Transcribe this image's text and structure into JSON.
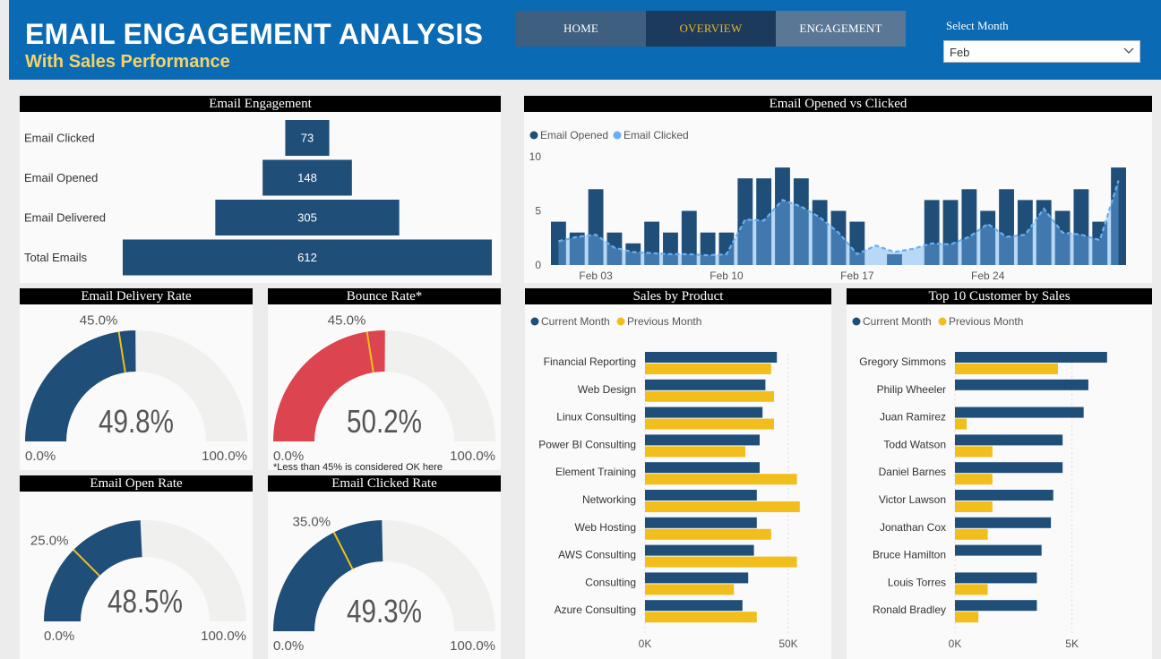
{
  "header": {
    "title": "EMAIL ENGAGEMENT ANALYSIS",
    "subtitle": "With Sales Performance",
    "nav": [
      "HOME",
      "OVERVIEW",
      "ENGAGEMENT"
    ],
    "select_label": "Select Month",
    "select_value": "Feb"
  },
  "colors": {
    "navy": "#1f4e79",
    "light_blue": "#6ab0f0",
    "yellow": "#f2be1b",
    "red": "#dc4450",
    "gauge_bg": "#f0f0ef"
  },
  "chart_data": [
    {
      "type": "bar",
      "title": "Email Engagement",
      "categories": [
        "Email Clicked",
        "Email Opened",
        "Email Delivered",
        "Total Emails"
      ],
      "values": [
        73,
        148,
        305,
        612
      ]
    },
    {
      "type": "line",
      "title": "Email Opened vs Clicked",
      "legend": [
        "Email Opened",
        "Email Clicked"
      ],
      "x_ticks": [
        "Feb 03",
        "Feb 10",
        "Feb 17",
        "Feb 24"
      ],
      "y_ticks": [
        "0",
        "5",
        "10"
      ],
      "ylim": [
        0,
        10
      ],
      "series": [
        {
          "name": "Email Opened",
          "values": [
            4,
            3,
            7,
            3,
            2,
            4,
            3,
            5,
            3,
            3,
            8,
            8,
            9,
            8,
            6,
            5,
            4,
            0,
            1,
            0,
            6,
            6,
            7,
            5,
            7,
            6,
            6,
            5,
            7,
            4,
            9
          ]
        },
        {
          "name": "Email Clicked",
          "values": [
            2.2,
            2.6,
            2.8,
            1.6,
            1.2,
            1.1,
            1.0,
            1.0,
            0.9,
            1.0,
            4.2,
            4.1,
            6.0,
            5.4,
            4.4,
            3.0,
            1.0,
            1.8,
            1.2,
            1.5,
            2.0,
            1.9,
            2.6,
            3.8,
            2.6,
            2.8,
            5.2,
            3.0,
            2.8,
            2.3,
            7.8
          ]
        }
      ]
    },
    {
      "type": "gauge",
      "title": "Email Delivery Rate",
      "value_label": "49.8%",
      "value": 49.8,
      "target_label": "45.0%",
      "target": 45.0,
      "min_label": "0.0%",
      "max_label": "100.0%"
    },
    {
      "type": "gauge",
      "title": "Bounce Rate*",
      "value_label": "50.2%",
      "value": 50.2,
      "target_label": "45.0%",
      "target": 45.0,
      "min_label": "0.0%",
      "max_label": "100.0%",
      "note": "*Less than 45% is considered OK here"
    },
    {
      "type": "gauge",
      "title": "Email Open Rate",
      "value_label": "48.5%",
      "value": 48.5,
      "target_label": "25.0%",
      "target": 25.0,
      "min_label": "0.0%",
      "max_label": "100.0%"
    },
    {
      "type": "gauge",
      "title": "Email Clicked Rate",
      "value_label": "49.3%",
      "value": 49.3,
      "target_label": "35.0%",
      "target": 35.0,
      "min_label": "0.0%",
      "max_label": "100.0%"
    },
    {
      "type": "bar",
      "title": "Sales by Product",
      "legend": [
        "Current Month",
        "Previous Month"
      ],
      "categories": [
        "Financial Reporting",
        "Web Design",
        "Linux Consulting",
        "Power BI Consulting",
        "Element Training",
        "Networking",
        "Web Hosting",
        "AWS Consulting",
        "Consulting",
        "Azure Consulting"
      ],
      "series": [
        {
          "name": "Current Month",
          "values": [
            46000,
            42000,
            41000,
            40000,
            40000,
            39000,
            39000,
            38000,
            36000,
            34000
          ]
        },
        {
          "name": "Previous Month",
          "values": [
            44000,
            45000,
            45000,
            35000,
            53000,
            54000,
            44000,
            53000,
            31000,
            39000
          ]
        }
      ],
      "x_ticks": [
        "0K",
        "50K"
      ],
      "xlim": [
        0,
        65000
      ]
    },
    {
      "type": "bar",
      "title": "Top 10 Customer by Sales",
      "legend": [
        "Current Month",
        "Previous Month"
      ],
      "categories": [
        "Gregory Simmons",
        "Philip Wheeler",
        "Juan Ramirez",
        "Todd Watson",
        "Daniel Barnes",
        "Victor Lawson",
        "Jonathan Cox",
        "Bruce Hamilton",
        "Louis Torres",
        "Ronald Bradley"
      ],
      "series": [
        {
          "name": "Current Month",
          "values": [
            6500,
            5700,
            5500,
            4600,
            4600,
            4200,
            4100,
            3700,
            3500,
            3500
          ]
        },
        {
          "name": "Previous Month",
          "values": [
            4400,
            0,
            500,
            1600,
            1600,
            1600,
            1400,
            0,
            1400,
            1000
          ]
        }
      ],
      "x_ticks": [
        "0K",
        "5K"
      ],
      "xlim": [
        0,
        8000
      ]
    }
  ]
}
